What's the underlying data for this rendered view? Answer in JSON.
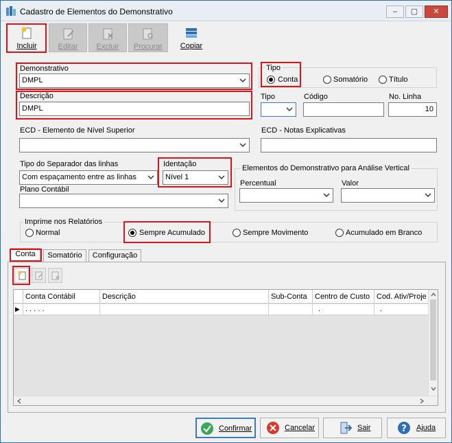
{
  "window": {
    "title": "Cadastro de Elementos do Demonstrativo",
    "min": "–",
    "max": "▢",
    "close": "✕"
  },
  "toolbar": {
    "incluir": "Incluir",
    "editar": "Editar",
    "excluir": "Excluir",
    "procurar": "Procurar",
    "copiar": "Copiar"
  },
  "form": {
    "demonstrativo_label": "Demonstrativo",
    "demonstrativo_value": "DMPL",
    "descricao_label": "Descrição",
    "descricao_value": "DMPL",
    "tipo_group_label": "Tipo",
    "tipo_options": [
      "Conta",
      "Somatório",
      "Título"
    ],
    "tipo_selected": "Conta",
    "tipo_label": "Tipo",
    "tipo_value": "",
    "codigo_label": "Código",
    "codigo_value": "",
    "nolinha_label": "No. Linha",
    "nolinha_value": "10",
    "ecd_superior_label": "ECD - Elemento de Nível Superior",
    "ecd_superior_value": "",
    "ecd_notas_label": "ECD - Notas Explicativas",
    "ecd_notas_value": "",
    "separador_label": "Tipo do Separador das linhas",
    "separador_value": "Com espaçamento entre as linhas",
    "identacao_label": "Identação",
    "identacao_value": "Nível 1",
    "plano_label": "Plano Contábil",
    "plano_value": "",
    "analise_group_label": "Elementos do Demonstrativo para Análise Vertical",
    "percentual_label": "Percentual",
    "percentual_value": "",
    "valor_label": "Valor",
    "valor_value": "",
    "imprime_group_label": "Imprime nos Relatórios",
    "imprime_options": [
      "Normal",
      "Sempre Acumulado",
      "Sempre Movimento",
      "Acumulado em Branco"
    ],
    "imprime_selected": "Sempre Acumulado"
  },
  "tabs": [
    "Conta",
    "Somatório",
    "Configuração"
  ],
  "active_tab": "Conta",
  "grid": {
    "columns": [
      "Conta Contábil",
      "Descrição",
      "Sub-Conta",
      "Centro de Custo",
      "Cod. Ativ/Proje"
    ],
    "rows": [
      {
        "indicator": "▶",
        "cells": [
          ". . . . .",
          "",
          "",
          ".",
          "."
        ]
      }
    ]
  },
  "footer": {
    "confirmar": "Confirmar",
    "cancelar": "Cancelar",
    "sair": "Sair",
    "ajuda": "Ajuda"
  },
  "colors": {
    "highlight": "#d9141b",
    "accent": "#3a7ac8"
  }
}
